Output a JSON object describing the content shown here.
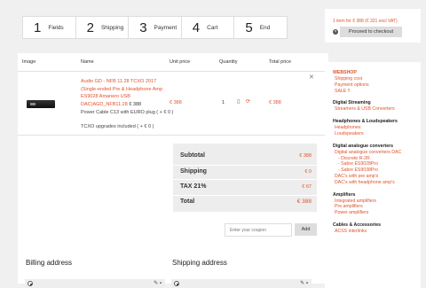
{
  "steps": [
    {
      "num": "1",
      "label": "Fields"
    },
    {
      "num": "2",
      "label": "Shipping"
    },
    {
      "num": "3",
      "label": "Payment"
    },
    {
      "num": "4",
      "label": "Cart"
    },
    {
      "num": "5",
      "label": "End"
    }
  ],
  "cart_table": {
    "headers": {
      "image": "Image",
      "name": "Name",
      "unit_price": "Unit price",
      "quantity": "Quantity",
      "total_price": "Total price"
    },
    "item": {
      "name_line1": "Audio GD - NFB 11.28 TCXO 2017",
      "name_line2": "(Single-ended Pre & Headphone Amp",
      "name_line3": "ES9028 Amanero USB",
      "name_line4": "DAC)AGD_NFB11.28",
      "inline_price": "€ 388",
      "option1": "Power Cable C13 with EURO plug ( + € 0 )",
      "option2": "TCXO upgrades included ( + € 0 )",
      "unit_price": "€ 388",
      "quantity": "1",
      "total_price": "€ 388"
    }
  },
  "totals": {
    "subtotal_label": "Subtotal",
    "subtotal_value": "€ 388",
    "shipping_label": "Shipping",
    "shipping_value": "€ 0",
    "tax_label": "TAX 21%",
    "tax_value": "€ 67",
    "total_label": "Total",
    "total_value": "€ 388"
  },
  "coupon": {
    "placeholder": "Enter your coupon",
    "apply_label": "Add"
  },
  "addresses": {
    "billing_title": "Billing address",
    "shipping_title": "Shipping address"
  },
  "cart_box": {
    "summary": "1 item for € 388 (€ 321 excl VAT)",
    "checkout_label": "Proceed to checkout"
  },
  "sidebar": {
    "categories": [
      {
        "title": "WEBSHOP",
        "highlight": true,
        "links": [
          "Shipping cost",
          "Payment options",
          "SALE !!"
        ]
      },
      {
        "title": "Digital Streaming",
        "links": [
          "Streamers & USB Converters"
        ]
      },
      {
        "title": "Headphones & Loudspeakers",
        "links": [
          "Headphones",
          "Loudspeakers"
        ]
      },
      {
        "title": "Digital analogue converters",
        "links": [
          "Digital analogue converters DAC",
          "- Discrete R-2R",
          "- Sabre ES9028Pro",
          "- Sabre ES9038Pro",
          "DAC's with pre amp's",
          "DAC's with headphone amp's"
        ]
      },
      {
        "title": "Amplifiers",
        "links": [
          "Integrated amplifiers",
          "Pre amplifiers",
          "Power amplifiers"
        ]
      },
      {
        "title": "Cables & Accessories",
        "links": [
          "ACSS interlinks"
        ]
      }
    ]
  },
  "colors": {
    "accent": "#e0532b",
    "background": "#f0f0f0"
  }
}
